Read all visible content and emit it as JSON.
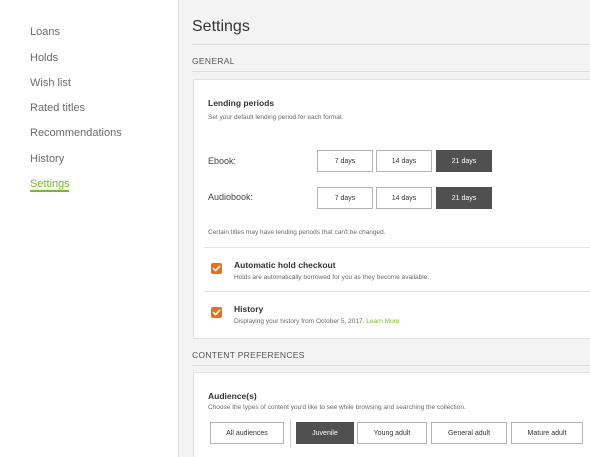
{
  "sidebar": {
    "items": [
      {
        "label": "Loans"
      },
      {
        "label": "Holds"
      },
      {
        "label": "Wish list"
      },
      {
        "label": "Rated titles"
      },
      {
        "label": "Recommendations"
      },
      {
        "label": "History"
      },
      {
        "label": "Settings",
        "active": true
      }
    ]
  },
  "main": {
    "title": "Settings",
    "general": {
      "heading": "GENERAL",
      "lending": {
        "title": "Lending periods",
        "subtitle": "Set your default lending period for each format.",
        "ebook": {
          "label": "Ebook:",
          "options": [
            "7 days",
            "14 days",
            "21 days"
          ],
          "selected": "21 days"
        },
        "audiobook": {
          "label": "Audiobook:",
          "options": [
            "7 days",
            "14 days",
            "21 days"
          ],
          "selected": "21 days"
        },
        "note": "Certain titles may have lending periods that can't be changed."
      },
      "auto_hold": {
        "title": "Automatic hold checkout",
        "subtitle": "Holds are automatically borrowed for you as they become available.",
        "checked": true
      },
      "history": {
        "title": "History",
        "subtitle": "Displaying your history from October 5, 2017.",
        "link": "Learn More",
        "checked": true
      }
    },
    "content": {
      "heading": "CONTENT PREFERENCES",
      "audience": {
        "title": "Audience(s)",
        "subtitle": "Choose the types of content you'd like to see while browsing and searching the collection.",
        "options": [
          "All audiences",
          "Juvenile",
          "Young adult",
          "General adult",
          "Mature adult"
        ],
        "selected": "Juvenile"
      }
    }
  },
  "colors": {
    "accent_green": "#7ab829",
    "checkbox_orange": "#e96f1b",
    "selected_button": "#505050"
  }
}
